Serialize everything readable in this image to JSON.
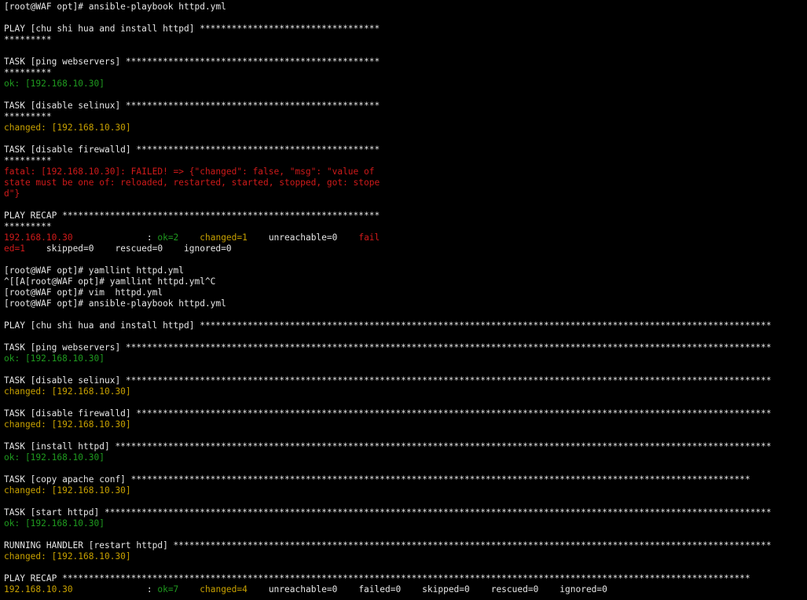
{
  "terminal": {
    "lines": [
      [
        {
          "t": "[root@WAF opt]# ansible-playbook httpd.yml",
          "c": "white"
        }
      ],
      [],
      [
        {
          "t": "PLAY [chu shi hua and install httpd] **********************************",
          "c": "white"
        }
      ],
      [
        {
          "t": "*********",
          "c": "white"
        }
      ],
      [],
      [
        {
          "t": "TASK [ping webservers] ************************************************",
          "c": "white"
        }
      ],
      [
        {
          "t": "*********",
          "c": "white"
        }
      ],
      [
        {
          "t": "ok: [192.168.10.30]",
          "c": "green"
        }
      ],
      [],
      [
        {
          "t": "TASK [disable selinux] ************************************************",
          "c": "white"
        }
      ],
      [
        {
          "t": "*********",
          "c": "white"
        }
      ],
      [
        {
          "t": "changed: [192.168.10.30]",
          "c": "yellow"
        }
      ],
      [],
      [
        {
          "t": "TASK [disable firewalld] **********************************************",
          "c": "white"
        }
      ],
      [
        {
          "t": "*********",
          "c": "white"
        }
      ],
      [
        {
          "t": "fatal: [192.168.10.30]: FAILED! => {\"changed\": false, \"msg\": \"value of",
          "c": "red"
        }
      ],
      [
        {
          "t": "state must be one of: reloaded, restarted, started, stopped, got: stope",
          "c": "red"
        }
      ],
      [
        {
          "t": "d\"}",
          "c": "red"
        }
      ],
      [],
      [
        {
          "t": "PLAY RECAP ************************************************************",
          "c": "white"
        }
      ],
      [
        {
          "t": "*********",
          "c": "white"
        }
      ],
      [
        {
          "t": "192.168.10.30",
          "c": "red"
        },
        {
          "t": "              : ",
          "c": "white"
        },
        {
          "t": "ok=2",
          "c": "green"
        },
        {
          "t": "    ",
          "c": "white"
        },
        {
          "t": "changed=1",
          "c": "yellow"
        },
        {
          "t": "    unreachable=0    ",
          "c": "white"
        },
        {
          "t": "fail",
          "c": "red"
        }
      ],
      [
        {
          "t": "ed=1",
          "c": "red"
        },
        {
          "t": "    skipped=0    rescued=0    ignored=0",
          "c": "white"
        }
      ],
      [],
      [
        {
          "t": "[root@WAF opt]# yamllint httpd.yml",
          "c": "white"
        }
      ],
      [
        {
          "t": "^[[A[root@WAF opt]# yamllint httpd.yml^C",
          "c": "white"
        }
      ],
      [
        {
          "t": "[root@WAF opt]# vim  httpd.yml",
          "c": "white"
        }
      ],
      [
        {
          "t": "[root@WAF opt]# ansible-playbook httpd.yml",
          "c": "white"
        }
      ],
      [],
      [
        {
          "t": "PLAY [chu shi hua and install httpd] ************************************************************************************************************",
          "c": "white"
        }
      ],
      [],
      [
        {
          "t": "TASK [ping webservers] **************************************************************************************************************************",
          "c": "white"
        }
      ],
      [
        {
          "t": "ok: [192.168.10.30]",
          "c": "green"
        }
      ],
      [],
      [
        {
          "t": "TASK [disable selinux] **************************************************************************************************************************",
          "c": "white"
        }
      ],
      [
        {
          "t": "changed: [192.168.10.30]",
          "c": "yellow"
        }
      ],
      [],
      [
        {
          "t": "TASK [disable firewalld] ************************************************************************************************************************",
          "c": "white"
        }
      ],
      [
        {
          "t": "changed: [192.168.10.30]",
          "c": "yellow"
        }
      ],
      [],
      [
        {
          "t": "TASK [install httpd] ****************************************************************************************************************************",
          "c": "white"
        }
      ],
      [
        {
          "t": "ok: [192.168.10.30]",
          "c": "green"
        }
      ],
      [],
      [
        {
          "t": "TASK [copy apache conf] *********************************************************************************************************************",
          "c": "white"
        }
      ],
      [
        {
          "t": "changed: [192.168.10.30]",
          "c": "yellow"
        }
      ],
      [],
      [
        {
          "t": "TASK [start httpd] ******************************************************************************************************************************",
          "c": "white"
        }
      ],
      [
        {
          "t": "ok: [192.168.10.30]",
          "c": "green"
        }
      ],
      [],
      [
        {
          "t": "RUNNING HANDLER [restart httpd] *****************************************************************************************************************",
          "c": "white"
        }
      ],
      [
        {
          "t": "changed: [192.168.10.30]",
          "c": "yellow"
        }
      ],
      [],
      [
        {
          "t": "PLAY RECAP **********************************************************************************************************************************",
          "c": "white"
        }
      ],
      [
        {
          "t": "192.168.10.30",
          "c": "yellow"
        },
        {
          "t": "              : ",
          "c": "white"
        },
        {
          "t": "ok=7",
          "c": "green"
        },
        {
          "t": "    ",
          "c": "white"
        },
        {
          "t": "changed=4",
          "c": "yellow"
        },
        {
          "t": "    unreachable=0    failed=0    skipped=0    rescued=0    ignored=0",
          "c": "white"
        }
      ]
    ]
  },
  "colors": {
    "background": "#000000",
    "white": "#e6e6e6",
    "green": "#1f9a1f",
    "yellow": "#c8a100",
    "red": "#d01a1a"
  }
}
